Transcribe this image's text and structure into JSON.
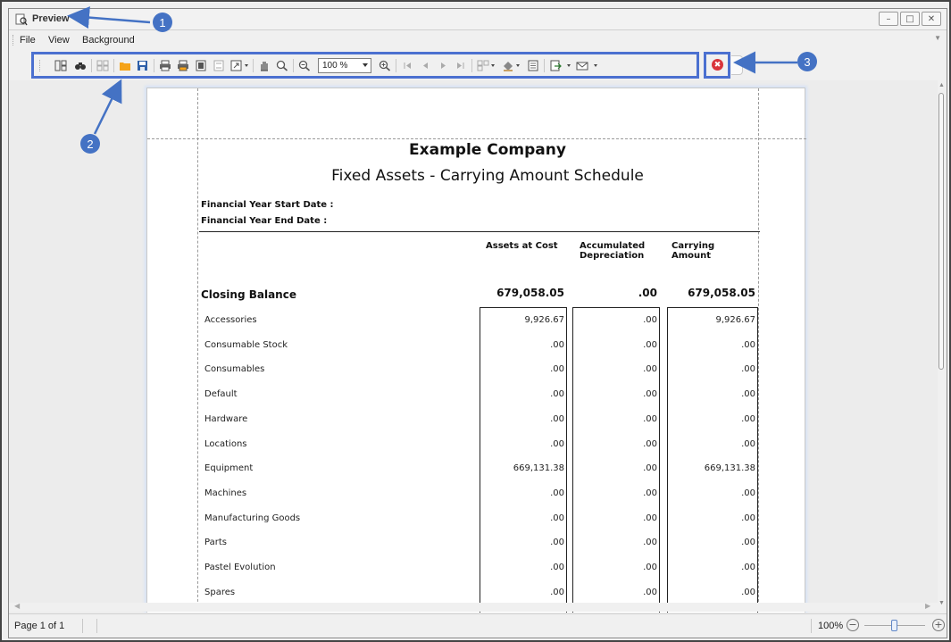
{
  "window": {
    "title": "Preview",
    "min_glyph": "–",
    "max_glyph": "□",
    "close_glyph": "✕"
  },
  "menu": {
    "items": [
      "File",
      "View",
      "Background"
    ]
  },
  "toolbar": {
    "zoom_value": "100 %",
    "icons": [
      "document-map-icon",
      "search-icon",
      "thumbnails-icon",
      "open-icon",
      "save-icon",
      "print-icon",
      "quick-print-icon",
      "page-setup-icon",
      "header-footer-icon",
      "scale-icon",
      "hand-tool-icon",
      "magnifier-icon",
      "zoom-out-icon",
      "zoom-in-icon",
      "first-page-icon",
      "previous-page-icon",
      "next-page-icon",
      "last-page-icon",
      "multiple-pages-icon",
      "fill-background-icon",
      "watermark-icon",
      "export-icon",
      "send-email-icon"
    ]
  },
  "close_preview": {
    "glyph": "✖"
  },
  "callouts": [
    "1",
    "2",
    "3"
  ],
  "report": {
    "company": "Example Company",
    "title": "Fixed Assets - Carrying Amount Schedule",
    "start_label": "Financial Year Start Date :",
    "end_label": "Financial Year End Date :",
    "col_cost": "Assets at Cost",
    "col_depr_1": "Accumulated",
    "col_depr_2": "Depreciation",
    "col_carry_1": "Carrying",
    "col_carry_2": "Amount",
    "closing_label": "Closing Balance",
    "closing": {
      "cost": "679,058.05",
      "depr": ".00",
      "carry": "679,058.05"
    },
    "rows": [
      {
        "label": "Accessories",
        "cost": "9,926.67",
        "depr": ".00",
        "carry": "9,926.67"
      },
      {
        "label": "Consumable Stock",
        "cost": ".00",
        "depr": ".00",
        "carry": ".00"
      },
      {
        "label": "Consumables",
        "cost": ".00",
        "depr": ".00",
        "carry": ".00"
      },
      {
        "label": "Default",
        "cost": ".00",
        "depr": ".00",
        "carry": ".00"
      },
      {
        "label": "Hardware",
        "cost": ".00",
        "depr": ".00",
        "carry": ".00"
      },
      {
        "label": "Locations",
        "cost": ".00",
        "depr": ".00",
        "carry": ".00"
      },
      {
        "label": "Equipment",
        "cost": "669,131.38",
        "depr": ".00",
        "carry": "669,131.38"
      },
      {
        "label": "Machines",
        "cost": ".00",
        "depr": ".00",
        "carry": ".00"
      },
      {
        "label": "Manufacturing Goods",
        "cost": ".00",
        "depr": ".00",
        "carry": ".00"
      },
      {
        "label": "Parts",
        "cost": ".00",
        "depr": ".00",
        "carry": ".00"
      },
      {
        "label": "Pastel Evolution",
        "cost": ".00",
        "depr": ".00",
        "carry": ".00"
      },
      {
        "label": "Spares",
        "cost": ".00",
        "depr": ".00",
        "carry": ".00"
      }
    ]
  },
  "status": {
    "page": "Page 1 of 1",
    "zoom": "100%",
    "zoom_minus": "−",
    "zoom_plus": "+",
    "zoom_level": 0.5
  },
  "colors": {
    "annotation": "#4472c4",
    "close_red": "#d9343a"
  }
}
